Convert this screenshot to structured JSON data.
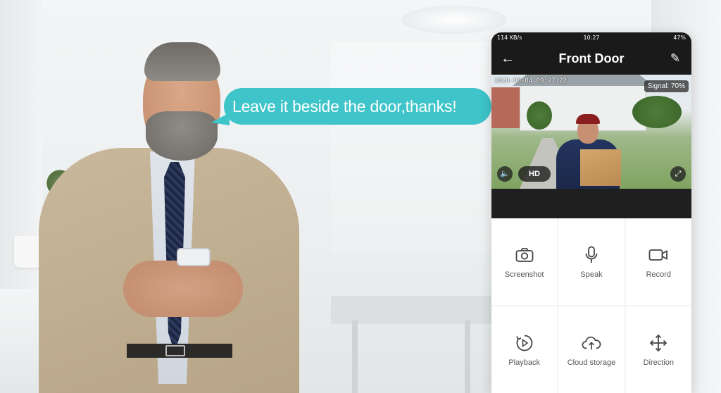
{
  "bubble": {
    "text": "Leave it beside the door,thanks!"
  },
  "status": {
    "left": "114 KB/s",
    "time": "10:27",
    "right": "47%"
  },
  "app": {
    "title": "Front Door"
  },
  "video": {
    "timestamp": "2020-08-04 09:27:22",
    "signal": "Signal: 70%",
    "hd_label": "HD"
  },
  "controls": [
    {
      "label": "Screenshot",
      "icon": "camera-icon"
    },
    {
      "label": "Speak",
      "icon": "microphone-icon"
    },
    {
      "label": "Record",
      "icon": "video-record-icon"
    },
    {
      "label": "Playback",
      "icon": "playback-icon"
    },
    {
      "label": "Cloud storage",
      "icon": "cloud-upload-icon"
    },
    {
      "label": "Direction",
      "icon": "direction-arrows-icon"
    }
  ],
  "colors": {
    "bubble": "#3ec4c9",
    "appbar": "#1a1a1a",
    "icon": "#444444"
  }
}
